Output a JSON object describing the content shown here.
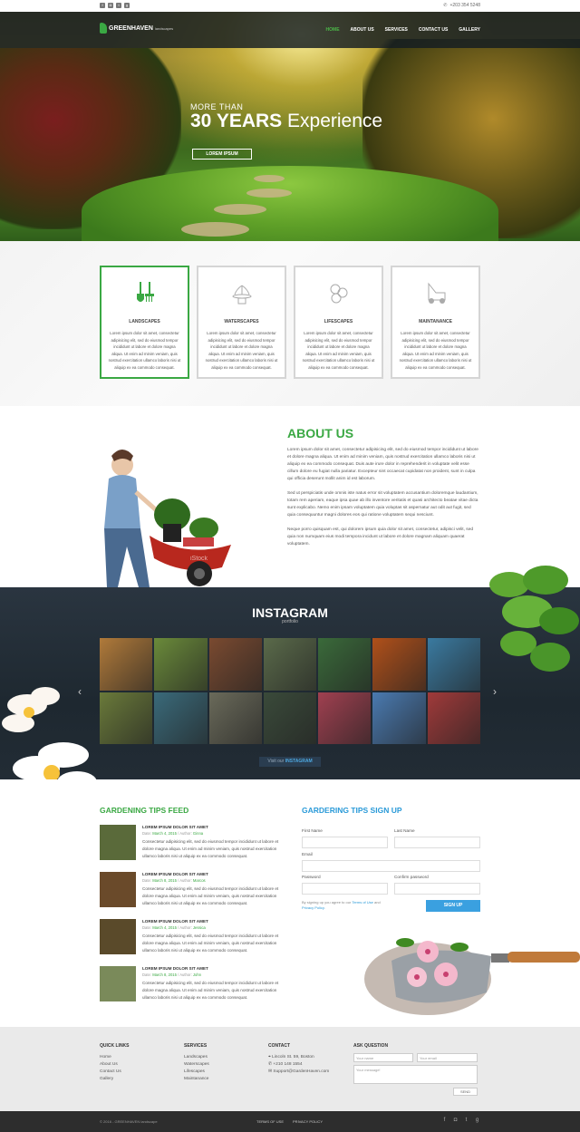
{
  "topbar": {
    "social": [
      "f",
      "ig",
      "tw",
      "g+"
    ],
    "phone": "+203 354 5248"
  },
  "logo": {
    "name": "GREENHAVEN",
    "sub": "landscapes"
  },
  "nav": {
    "items": [
      "HOME",
      "ABOUT US",
      "SERVICES",
      "CONTACT US",
      "GALLERY"
    ],
    "active": "HOME"
  },
  "hero": {
    "line1": "MORE THAN",
    "line2a": "30 YEARS",
    "line2b": "Experience",
    "button": "LOREM IPSUM"
  },
  "services": [
    {
      "title": "LANDSCAPES",
      "icon": "shovel-rake-icon",
      "text": "Lorem ipsum dolor sit amet, consectetur adipisicing elit, sed do eiusmod tempor incididunt ut labore et dolore magna aliqua. Ut enim ad minim veniam, quis nostrud exercitation ullamco laboris nisi ut aliquip ex ea commodo consequat."
    },
    {
      "title": "WATERSCAPES",
      "icon": "fountain-icon",
      "text": "Lorem ipsum dolor sit amet, consectetur adipisicing elit, sed do eiusmod tempor incididunt ut labore et dolore magna aliqua. Ut enim ad minim veniam, quis nostrud exercitation ullamco laboris nisi ut aliquip ex ea commodo consequat."
    },
    {
      "title": "LIFESCAPES",
      "icon": "flowers-icon",
      "text": "Lorem ipsum dolor sit amet, consectetur adipisicing elit, sed do eiusmod tempor incididunt ut labore et dolore magna aliqua. Ut enim ad minim veniam, quis nostrud exercitation ullamco laboris nisi ut aliquip ex ea commodo consequat."
    },
    {
      "title": "MAINTANANCE",
      "icon": "lawnmower-icon",
      "text": "Lorem ipsum dolor sit amet, consectetur adipisicing elit, sed do eiusmod tempor incididunt ut labore et dolore magna aliqua. Ut enim ad minim veniam, quis nostrud exercitation ullamco laboris nisi ut aliquip ex ea commodo consequat."
    }
  ],
  "about": {
    "title": "ABOUT US",
    "p1": "Lorem ipsum dolor sit amet, consectetur adipisicing elit, sed do eiusmod tempor incididunt ut labore et dolore magna aliqua. Ut enim ad minim veniam, quis nostrud exercitation ullamco laboris nisi ut aliquip ex ea commodo consequat. Duis aute irure dolor in reprehenderit in voluptate velit esse cillum dolore eu fugiat nulla pariatur. Excepteur sint occaecat cupidatat non proident, sunt in culpa qui officia deserunt mollit anim id est laborum.",
    "p2": "Sed ut perspiciatis unde omnis iste natus error sit voluptatem accusantium doloremque laudantium, totam rem aperiam, eaque ipsa quae ab illo inventore veritatis et quasi architecto beatae vitae dicta sunt explicabo. Nemo enim ipsam voluptatem quia voluptas sit aspernatur aut odit aut fugit, sed quia consequuntur magni dolores eos qui ratione voluptatem sequi nesciunt.",
    "p3": "Neque porro quisquam est, qui dolorem ipsum quia dolor sit amet, consectetur, adipisci velit, sed quia non numquam eius modi tempora incidunt ut labore et dolore magnam aliquam quaerat voluptatem.",
    "watermark": "iStock"
  },
  "instagram": {
    "title": "INSTAGRAM",
    "subtitle": "portfolio",
    "button_pre": "Visit our",
    "button_b": "INSTAGRAM",
    "tiles": [
      "#b07a3a",
      "#6a8a3a",
      "#7a4a30",
      "#5a6a4a",
      "#3a6a3a",
      "#b0501a",
      "#3a7aa0",
      "#6a7a3a",
      "#3a6a7a",
      "#6a6a5a",
      "#3a4a3a",
      "#a04050",
      "#4a7ab0",
      "#a03a3a"
    ]
  },
  "tips": {
    "title": "GARDENING TIPS FEED",
    "posts": [
      {
        "title": "LOREM IPSUM DOLOR SIT AMET",
        "date_label": "Date:",
        "date": "March 4, 2015",
        "author_label": "Author:",
        "author": "Ginna",
        "text": "Consectetur adipisicing elit, sed do eiusmod tempor incididunt ut labore et dolore magna aliqua. Ut enim ad minim veniam, quis nostrud exercitation ullamco laboris nisi ut aliquip ex ea commodo consequat.",
        "thumb": "#5a6a3a"
      },
      {
        "title": "LOREM IPSUM DOLOR SIT AMET",
        "date_label": "Date:",
        "date": "March 8, 2015",
        "author_label": "Author:",
        "author": "Marcos",
        "text": "Consectetur adipisicing elit, sed do eiusmod tempor incididunt ut labore et dolore magna aliqua. Ut enim ad minim veniam, quis nostrud exercitation ullamco laboris nisi ut aliquip ex ea commodo consequat.",
        "thumb": "#6a4a2a"
      },
      {
        "title": "LOREM IPSUM DOLOR SIT AMET",
        "date_label": "Date:",
        "date": "March 4, 2015",
        "author_label": "Author:",
        "author": "Jessica",
        "text": "Consectetur adipisicing elit, sed do eiusmod tempor incididunt ut labore et dolore magna aliqua. Ut enim ad minim veniam, quis nostrud exercitation ullamco laboris nisi ut aliquip ex ea commodo consequat.",
        "thumb": "#5a4a2a"
      },
      {
        "title": "LOREM IPSUM DOLOR SIT AMET",
        "date_label": "Date:",
        "date": "March 8, 2015",
        "author_label": "Author:",
        "author": "John",
        "text": "Consectetur adipisicing elit, sed do eiusmod tempor incididunt ut labore et dolore magna aliqua. Ut enim ad minim veniam, quis nostrud exercitation ullamco laboris nisi ut aliquip ex ea commodo consequat.",
        "thumb": "#7a8a5a"
      }
    ]
  },
  "signup": {
    "title": "GARDERING TIPS SIGN UP",
    "first": "First Name",
    "last": "Last Name",
    "email": "Email",
    "password": "Password",
    "confirm": "Confirm password",
    "terms_pre": "By signing up you agree to our",
    "terms": "Terms of Use",
    "and": "and",
    "privacy": "Privacy Policy.",
    "button": "SIGN UP"
  },
  "footer": {
    "quick": {
      "title": "QUICK LINKS",
      "items": [
        "Home",
        "About Us",
        "Contact Us",
        "Gallery"
      ]
    },
    "services": {
      "title": "SERVICES",
      "items": [
        "Landscapes",
        "Waterscapes",
        "Lifescapes",
        "Maintanance"
      ]
    },
    "contact": {
      "title": "CONTACT",
      "address": "Lincoln St. 59, Boston",
      "phone": "+210 148 1554",
      "email": "Support@GardenHaven.com"
    },
    "ask": {
      "title": "ASK QUESTION",
      "name_ph": "Your name",
      "email_ph": "Your email",
      "msg_ph": "Your message!",
      "send": "SEND"
    }
  },
  "bottom": {
    "copy": "© 2016 - GREENHAVEN landscape",
    "terms": "TERMS OF USE",
    "privacy": "PRIVACY POLICY",
    "social": [
      "f",
      "ig",
      "tw",
      "g+"
    ]
  },
  "colors": {
    "green": "#3aa843",
    "blue": "#2a9ad8",
    "dark": "#1e2830"
  }
}
